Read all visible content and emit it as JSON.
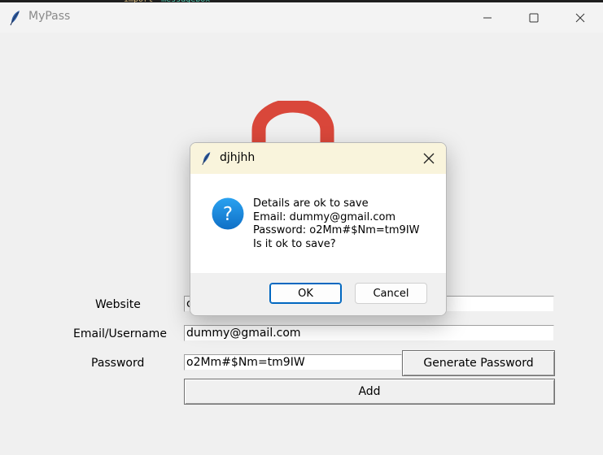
{
  "background_code": {
    "keyword": "import",
    "module": "messagebox"
  },
  "window": {
    "title": "MyPass"
  },
  "form": {
    "website": {
      "label": "Website",
      "value": "c"
    },
    "email": {
      "label": "Email/Username",
      "value": "dummy@gmail.com"
    },
    "password": {
      "label": "Password",
      "value": "o2Mm#$Nm=tm9IW"
    },
    "generate_label": "Generate Password",
    "add_label": "Add"
  },
  "dialog": {
    "title": "djhjhh",
    "icon": "question-icon",
    "lines": [
      "Details are ok to save",
      "Email: dummy@gmail.com",
      "Password: o2Mm#$Nm=tm9IW",
      "Is it ok to save?"
    ],
    "ok_label": "OK",
    "cancel_label": "Cancel"
  },
  "colors": {
    "logo_red": "#d9473a",
    "dialog_title_bg": "#f9f4dc",
    "accent": "#0067c0",
    "question_blue": "#1a8ae6"
  }
}
